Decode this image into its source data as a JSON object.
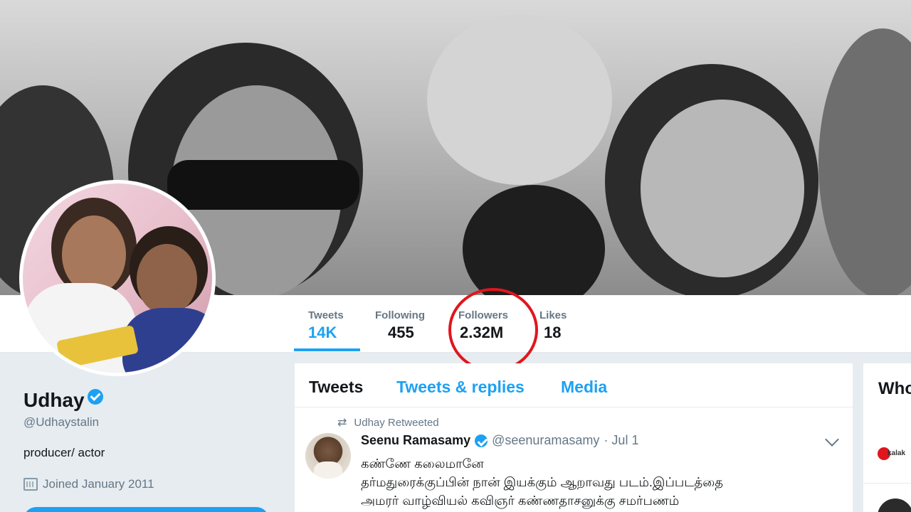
{
  "profile": {
    "name": "Udhay",
    "handle": "@Udhaystalin",
    "bio": "producer/ actor",
    "joined": "Joined January 2011",
    "verified_icon": "verified-badge-icon",
    "calendar_icon": "calendar-icon"
  },
  "stats": [
    {
      "label": "Tweets",
      "value": "14K"
    },
    {
      "label": "Following",
      "value": "455"
    },
    {
      "label": "Followers",
      "value": "2.32M"
    },
    {
      "label": "Likes",
      "value": "18"
    }
  ],
  "timeline": {
    "tabs": [
      "Tweets",
      "Tweets & replies",
      "Media"
    ],
    "retweet_label": "Udhay Retweeted",
    "tweet": {
      "author": "Seenu Ramasamy",
      "handle": "@seenuramasamy",
      "date": "· Jul 1",
      "text": "கண்ணே கலைமானே\nதர்மதுரைக்குப்பின் நான் இயக்கும் ஆறாவது படம்.இப்படத்தை\nஅமரர் வாழ்வியல் கவிஞர் கண்ணதாசனுக்கு சமர்பணம்"
    }
  },
  "right_panel": {
    "title": "Who",
    "logo_text": "kalak"
  },
  "colors": {
    "accent": "#1da1f2",
    "highlight": "#e0161c",
    "page_bg": "#e6ecf0"
  }
}
